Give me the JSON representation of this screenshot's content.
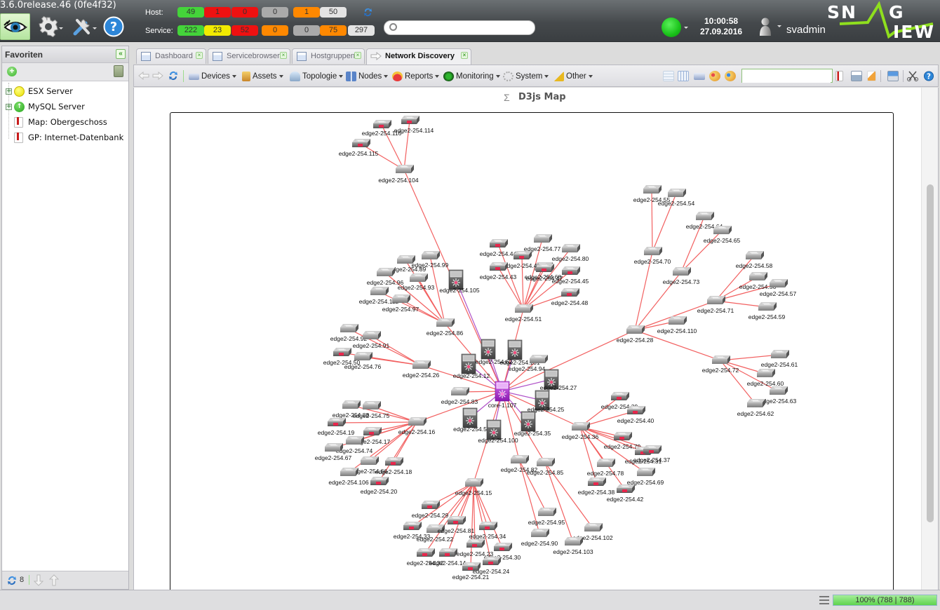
{
  "app": {
    "version": "3.6.0release.46 (0fe4f32)",
    "brand": "SNAG VIEW"
  },
  "header": {
    "icons": [
      "eye-menu-icon",
      "gear-menu-icon",
      "tools-menu-icon",
      "help-icon"
    ],
    "host_label": "Host:",
    "service_label": "Service:",
    "host_counts": [
      {
        "value": "49",
        "color": "#44d43a"
      },
      {
        "value": "1",
        "color": "#ee1111"
      },
      {
        "value": "0",
        "color": "#ee1111"
      },
      {
        "value": "0",
        "color": "#aaaaaa"
      },
      {
        "value": "1",
        "color": "#ff8800"
      },
      {
        "value": "50",
        "color": "#e4e4e4"
      }
    ],
    "service_counts": [
      {
        "value": "222",
        "color": "#44d43a"
      },
      {
        "value": "23",
        "color": "#f2ea00"
      },
      {
        "value": "52",
        "color": "#ee1111"
      },
      {
        "value": "0",
        "color": "#ff8800"
      },
      {
        "value": "0",
        "color": "#aaaaaa"
      },
      {
        "value": "75",
        "color": "#ff8800"
      },
      {
        "value": "297",
        "color": "#e4e4e4"
      }
    ],
    "search_placeholder": "",
    "status_color": "#22c41a",
    "time": "10:00:58",
    "date": "27.09.2016",
    "username": "svadmin"
  },
  "sidebar": {
    "title": "Favoriten",
    "items": [
      {
        "label": "ESX Server",
        "icon": "yellow-status-icon",
        "expandable": true
      },
      {
        "label": "MySQL Server",
        "icon": "green-up-status-icon",
        "expandable": true
      },
      {
        "label": "Map: Obergeschoss",
        "icon": "bookmark-icon",
        "expandable": false
      },
      {
        "label": "GP: Internet-Datenbank",
        "icon": "bookmark-icon",
        "expandable": false
      }
    ],
    "footer_count": "8"
  },
  "tabs": [
    {
      "label": "Dashboard",
      "active": false
    },
    {
      "label": "Servicebrowser",
      "active": false
    },
    {
      "label": "Hostgruppen",
      "active": false
    },
    {
      "label": "Network Discovery",
      "active": true
    }
  ],
  "toolbar": {
    "menus": [
      "Devices",
      "Assets",
      "Topologie",
      "Nodes",
      "Reports",
      "Monitoring",
      "System",
      "Other"
    ],
    "search_value": ""
  },
  "map": {
    "title": "D3js Map",
    "edge_colors": {
      "normal": "#f26060",
      "core": "#b052c8"
    },
    "nodes": [
      {
        "id": "core-1.107",
        "type": "core"
      },
      {
        "id": "edge2-254.12",
        "type": "chassis"
      },
      {
        "id": "edge2-254.62",
        "type": "chassis"
      },
      {
        "id": "edge2-254.101",
        "type": "chassis"
      },
      {
        "id": "edge2-254.105",
        "type": "chassis"
      },
      {
        "id": "edge2-254.27",
        "type": "chassis"
      },
      {
        "id": "edge2-254.25",
        "type": "chassis"
      },
      {
        "id": "edge2-254.5",
        "type": "chassis"
      },
      {
        "id": "edge2-254.100",
        "type": "chassis"
      },
      {
        "id": "edge2-254.35",
        "type": "chassis"
      },
      {
        "id": "edge2-254.94",
        "type": "switch"
      },
      {
        "id": "edge2-254.83",
        "type": "switch"
      },
      {
        "id": "edge2-254.86",
        "type": "switch"
      },
      {
        "id": "edge2-254.26",
        "type": "switch"
      },
      {
        "id": "edge2-254.16",
        "type": "switch"
      },
      {
        "id": "edge2-254.15",
        "type": "switch"
      },
      {
        "id": "edge2-254.36",
        "type": "switch"
      },
      {
        "id": "edge2-254.28",
        "type": "switch"
      },
      {
        "id": "edge2-254.51",
        "type": "switch"
      },
      {
        "id": "edge2-254.104",
        "type": "switch"
      },
      {
        "id": "edge2-254.82",
        "type": "switch"
      },
      {
        "id": "edge2-254.85",
        "type": "switch"
      },
      {
        "id": "edge2-254.70",
        "type": "switch"
      },
      {
        "id": "edge2-254.73",
        "type": "switch"
      },
      {
        "id": "edge2-254.71",
        "type": "switch"
      },
      {
        "id": "edge2-254.72",
        "type": "switch"
      },
      {
        "id": "edge2-254.116",
        "type": "switch",
        "alarm": true
      },
      {
        "id": "edge2-254.114",
        "type": "switch",
        "alarm": true
      },
      {
        "id": "edge2-254.115",
        "type": "switch",
        "alarm": true
      },
      {
        "id": "edge2-254.77",
        "type": "switch"
      },
      {
        "id": "edge2-254.80",
        "type": "switch"
      },
      {
        "id": "edge2-254.44",
        "type": "switch",
        "alarm": true
      },
      {
        "id": "edge2-254.68",
        "type": "switch"
      },
      {
        "id": "edge2-254.41",
        "type": "switch",
        "alarm": true
      },
      {
        "id": "edge2-254.43",
        "type": "switch",
        "alarm": true
      },
      {
        "id": "edge2-254.47",
        "type": "switch",
        "alarm": true
      },
      {
        "id": "edge2-254.45",
        "type": "switch",
        "alarm": true
      },
      {
        "id": "edge2-254.48",
        "type": "switch",
        "alarm": true
      },
      {
        "id": "edge2-254.55",
        "type": "switch"
      },
      {
        "id": "edge2-254.54",
        "type": "switch"
      },
      {
        "id": "edge2-254.64",
        "type": "switch"
      },
      {
        "id": "edge2-254.65",
        "type": "switch"
      },
      {
        "id": "edge2-254.58",
        "type": "switch"
      },
      {
        "id": "edge2-254.56",
        "type": "switch"
      },
      {
        "id": "edge2-254.57",
        "type": "switch"
      },
      {
        "id": "edge2-254.59",
        "type": "switch"
      },
      {
        "id": "edge2-254.110",
        "type": "switch"
      },
      {
        "id": "edge2-254.61",
        "type": "switch"
      },
      {
        "id": "edge2-254.60",
        "type": "switch"
      },
      {
        "id": "edge2-254.63",
        "type": "switch"
      },
      {
        "id": "edge2-254.62b",
        "label": "edge2-254.62",
        "type": "switch"
      },
      {
        "id": "edge2-254.99",
        "type": "switch"
      },
      {
        "id": "edge2-254.89",
        "type": "switch"
      },
      {
        "id": "edge2-254.96",
        "type": "switch"
      },
      {
        "id": "edge2-254.93",
        "type": "switch"
      },
      {
        "id": "edge2-254.112",
        "type": "switch"
      },
      {
        "id": "edge2-254.97",
        "type": "switch"
      },
      {
        "id": "edge2-254.92",
        "type": "switch"
      },
      {
        "id": "edge2-254.91",
        "type": "switch"
      },
      {
        "id": "edge2-254.50",
        "type": "switch",
        "alarm": true
      },
      {
        "id": "edge2-254.76",
        "type": "switch"
      },
      {
        "id": "edge2-254.88",
        "type": "switch"
      },
      {
        "id": "edge2-254.75",
        "type": "switch"
      },
      {
        "id": "edge2-254.19",
        "type": "switch",
        "alarm": true
      },
      {
        "id": "edge2-254.17",
        "type": "switch",
        "alarm": true
      },
      {
        "id": "edge2-254.74",
        "type": "switch"
      },
      {
        "id": "edge2-254.67",
        "type": "switch"
      },
      {
        "id": "edge2-254.66",
        "type": "switch"
      },
      {
        "id": "edge2-254.18",
        "type": "switch",
        "alarm": true
      },
      {
        "id": "edge2-254.106",
        "type": "switch"
      },
      {
        "id": "edge2-254.20",
        "type": "switch",
        "alarm": true
      },
      {
        "id": "edge2-254.29",
        "type": "switch",
        "alarm": true
      },
      {
        "id": "edge2-254.33",
        "type": "switch",
        "alarm": true
      },
      {
        "id": "edge2-254.22",
        "type": "switch"
      },
      {
        "id": "edge2-254.81",
        "type": "switch",
        "alarm": true
      },
      {
        "id": "edge2-254.34",
        "type": "switch",
        "alarm": true
      },
      {
        "id": "edge2-254.23",
        "type": "switch",
        "alarm": true
      },
      {
        "id": "edge2-254.32",
        "type": "switch",
        "alarm": true
      },
      {
        "id": "edge2-254.14",
        "type": "switch",
        "alarm": true
      },
      {
        "id": "edge2-254.30",
        "type": "switch",
        "alarm": true
      },
      {
        "id": "edge2-254.21",
        "type": "switch",
        "alarm": true
      },
      {
        "id": "edge2-254.24",
        "type": "switch",
        "alarm": true
      },
      {
        "id": "edge2-254.95",
        "type": "switch"
      },
      {
        "id": "edge2-254.90",
        "type": "switch"
      },
      {
        "id": "edge2-254.102",
        "type": "switch"
      },
      {
        "id": "edge2-254.103",
        "type": "switch"
      },
      {
        "id": "edge2-254.39",
        "type": "switch",
        "alarm": true
      },
      {
        "id": "edge2-254.40",
        "type": "switch",
        "alarm": true
      },
      {
        "id": "edge2-254.79",
        "type": "switch",
        "alarm": true
      },
      {
        "id": "edge2-254.31",
        "type": "switch",
        "alarm": true
      },
      {
        "id": "edge2-254.37",
        "type": "switch",
        "alarm": true
      },
      {
        "id": "edge2-254.78",
        "type": "switch"
      },
      {
        "id": "edge2-254.69",
        "type": "switch"
      },
      {
        "id": "edge2-254.38",
        "type": "switch",
        "alarm": true
      },
      {
        "id": "edge2-254.42",
        "type": "switch",
        "alarm": true
      }
    ],
    "links": [
      [
        "core-1.107",
        "edge2-254.12",
        "core"
      ],
      [
        "core-1.107",
        "edge2-254.62",
        "core"
      ],
      [
        "core-1.107",
        "edge2-254.101",
        "core"
      ],
      [
        "core-1.107",
        "edge2-254.105",
        "core"
      ],
      [
        "core-1.107",
        "edge2-254.27",
        "core"
      ],
      [
        "core-1.107",
        "edge2-254.25",
        "core"
      ],
      [
        "core-1.107",
        "edge2-254.5",
        "core"
      ],
      [
        "core-1.107",
        "edge2-254.100",
        "core"
      ],
      [
        "core-1.107",
        "edge2-254.35",
        "core"
      ],
      [
        "core-1.107",
        "edge2-254.94"
      ],
      [
        "core-1.107",
        "edge2-254.83"
      ],
      [
        "core-1.107",
        "edge2-254.86"
      ],
      [
        "core-1.107",
        "edge2-254.26"
      ],
      [
        "core-1.107",
        "edge2-254.16"
      ],
      [
        "core-1.107",
        "edge2-254.15"
      ],
      [
        "core-1.107",
        "edge2-254.36"
      ],
      [
        "core-1.107",
        "edge2-254.28"
      ],
      [
        "core-1.107",
        "edge2-254.51"
      ],
      [
        "core-1.107",
        "edge2-254.104"
      ],
      [
        "core-1.107",
        "edge2-254.82"
      ],
      [
        "core-1.107",
        "edge2-254.85"
      ],
      [
        "edge2-254.104",
        "edge2-254.116"
      ],
      [
        "edge2-254.104",
        "edge2-254.114"
      ],
      [
        "edge2-254.104",
        "edge2-254.115"
      ],
      [
        "edge2-254.51",
        "edge2-254.77"
      ],
      [
        "edge2-254.51",
        "edge2-254.80"
      ],
      [
        "edge2-254.51",
        "edge2-254.44"
      ],
      [
        "edge2-254.51",
        "edge2-254.68"
      ],
      [
        "edge2-254.51",
        "edge2-254.41"
      ],
      [
        "edge2-254.51",
        "edge2-254.43"
      ],
      [
        "edge2-254.51",
        "edge2-254.47"
      ],
      [
        "edge2-254.51",
        "edge2-254.45"
      ],
      [
        "edge2-254.51",
        "edge2-254.48"
      ],
      [
        "edge2-254.28",
        "edge2-254.70"
      ],
      [
        "edge2-254.28",
        "edge2-254.73"
      ],
      [
        "edge2-254.28",
        "edge2-254.71"
      ],
      [
        "edge2-254.28",
        "edge2-254.110"
      ],
      [
        "edge2-254.28",
        "edge2-254.72"
      ],
      [
        "edge2-254.70",
        "edge2-254.55"
      ],
      [
        "edge2-254.70",
        "edge2-254.54"
      ],
      [
        "edge2-254.73",
        "edge2-254.64"
      ],
      [
        "edge2-254.73",
        "edge2-254.65"
      ],
      [
        "edge2-254.71",
        "edge2-254.58"
      ],
      [
        "edge2-254.71",
        "edge2-254.56"
      ],
      [
        "edge2-254.71",
        "edge2-254.57"
      ],
      [
        "edge2-254.71",
        "edge2-254.59"
      ],
      [
        "edge2-254.72",
        "edge2-254.61"
      ],
      [
        "edge2-254.72",
        "edge2-254.60"
      ],
      [
        "edge2-254.72",
        "edge2-254.63"
      ],
      [
        "edge2-254.72",
        "edge2-254.62b"
      ],
      [
        "edge2-254.86",
        "edge2-254.99"
      ],
      [
        "edge2-254.86",
        "edge2-254.89"
      ],
      [
        "edge2-254.86",
        "edge2-254.96"
      ],
      [
        "edge2-254.86",
        "edge2-254.93"
      ],
      [
        "edge2-254.86",
        "edge2-254.112"
      ],
      [
        "edge2-254.86",
        "edge2-254.97"
      ],
      [
        "edge2-254.26",
        "edge2-254.92"
      ],
      [
        "edge2-254.26",
        "edge2-254.91"
      ],
      [
        "edge2-254.26",
        "edge2-254.50"
      ],
      [
        "edge2-254.26",
        "edge2-254.76"
      ],
      [
        "edge2-254.16",
        "edge2-254.88"
      ],
      [
        "edge2-254.16",
        "edge2-254.75"
      ],
      [
        "edge2-254.16",
        "edge2-254.19"
      ],
      [
        "edge2-254.16",
        "edge2-254.17"
      ],
      [
        "edge2-254.16",
        "edge2-254.74"
      ],
      [
        "edge2-254.16",
        "edge2-254.67"
      ],
      [
        "edge2-254.16",
        "edge2-254.66"
      ],
      [
        "edge2-254.16",
        "edge2-254.18"
      ],
      [
        "edge2-254.16",
        "edge2-254.106"
      ],
      [
        "edge2-254.16",
        "edge2-254.20"
      ],
      [
        "edge2-254.15",
        "edge2-254.29"
      ],
      [
        "edge2-254.15",
        "edge2-254.33"
      ],
      [
        "edge2-254.15",
        "edge2-254.22"
      ],
      [
        "edge2-254.15",
        "edge2-254.81"
      ],
      [
        "edge2-254.15",
        "edge2-254.34"
      ],
      [
        "edge2-254.15",
        "edge2-254.23"
      ],
      [
        "edge2-254.15",
        "edge2-254.32"
      ],
      [
        "edge2-254.15",
        "edge2-254.14"
      ],
      [
        "edge2-254.15",
        "edge2-254.30"
      ],
      [
        "edge2-254.15",
        "edge2-254.21"
      ],
      [
        "edge2-254.15",
        "edge2-254.24"
      ],
      [
        "edge2-254.82",
        "edge2-254.95"
      ],
      [
        "edge2-254.82",
        "edge2-254.90"
      ],
      [
        "edge2-254.85",
        "edge2-254.102"
      ],
      [
        "edge2-254.85",
        "edge2-254.103"
      ],
      [
        "edge2-254.36",
        "edge2-254.39"
      ],
      [
        "edge2-254.36",
        "edge2-254.40"
      ],
      [
        "edge2-254.36",
        "edge2-254.79"
      ],
      [
        "edge2-254.36",
        "edge2-254.31"
      ],
      [
        "edge2-254.36",
        "edge2-254.37"
      ],
      [
        "edge2-254.36",
        "edge2-254.78"
      ],
      [
        "edge2-254.36",
        "edge2-254.69"
      ],
      [
        "edge2-254.36",
        "edge2-254.38"
      ],
      [
        "edge2-254.36",
        "edge2-254.42"
      ]
    ]
  },
  "statusbar": {
    "progress_text": "100% (788 | 788)",
    "progress_fraction": 1.0
  }
}
